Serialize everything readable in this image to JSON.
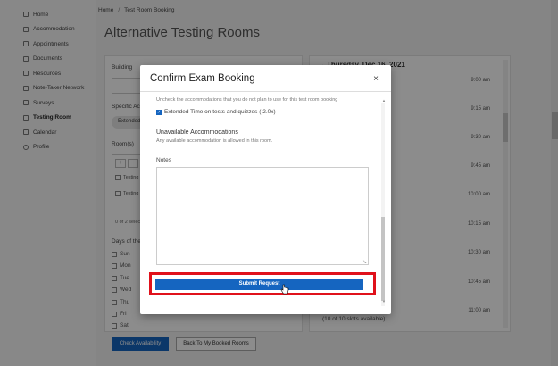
{
  "sidebar": {
    "items": [
      {
        "label": "Home",
        "icon": "home-icon",
        "active": false
      },
      {
        "label": "Accommodation",
        "icon": "accommodation-icon",
        "active": false
      },
      {
        "label": "Appointments",
        "icon": "calendar-icon",
        "active": false
      },
      {
        "label": "Documents",
        "icon": "document-icon",
        "active": false
      },
      {
        "label": "Resources",
        "icon": "folder-icon",
        "active": false
      },
      {
        "label": "Note-Taker Network",
        "icon": "notes-icon",
        "active": false
      },
      {
        "label": "Surveys",
        "icon": "survey-icon",
        "active": false
      },
      {
        "label": "Testing Room",
        "icon": "testing-room-icon",
        "active": true
      },
      {
        "label": "Calendar",
        "icon": "calendar-icon",
        "active": false
      },
      {
        "label": "Profile",
        "icon": "gear-icon",
        "active": false
      }
    ]
  },
  "breadcrumb": {
    "home": "Home",
    "sep": "/",
    "current": "Test Room Booking"
  },
  "page": {
    "title": "Alternative Testing Rooms"
  },
  "form": {
    "building_label": "Building",
    "specific_acc_label": "Specific Ac",
    "pill_text": "Extended",
    "rooms_label": "Room(s)",
    "rooms_tool_plus": "+",
    "rooms_tool_minus": "−",
    "rooms": [
      "Testing",
      "Testing"
    ],
    "rooms_count": "0 of 2 selec",
    "days_label": "Days of the",
    "days": [
      "Sun",
      "Mon",
      "Tue",
      "Wed",
      "Thu",
      "Fri",
      "Sat"
    ]
  },
  "buttons": {
    "check_availability": "Check Availability",
    "back": "Back To My Booked Rooms"
  },
  "schedule": {
    "day": "Thursday, Dec 16, 2021",
    "times": [
      "9:00 am",
      "9:15 am",
      "9:30 am",
      "9:45 am",
      "10:00 am",
      "10:15 am",
      "10:30 am",
      "10:45 am",
      "11:00 am"
    ],
    "slots_note": "(10 of 10 slots available)"
  },
  "modal": {
    "title": "Confirm Exam Booking",
    "close": "×",
    "hint": "Uncheck the accommodations that you do not plan to use for this test room booking",
    "accommodation": "Extended Time on tests and quizzes ( 2.0x)",
    "unavailable_title": "Unavailable Accommodations",
    "unavailable_desc": "Any available accommodation is allowed in this room.",
    "notes_label": "Notes",
    "notes_value": "",
    "submit": "Submit Request"
  },
  "colors": {
    "primary": "#1565c0",
    "highlight": "#e0111b"
  }
}
